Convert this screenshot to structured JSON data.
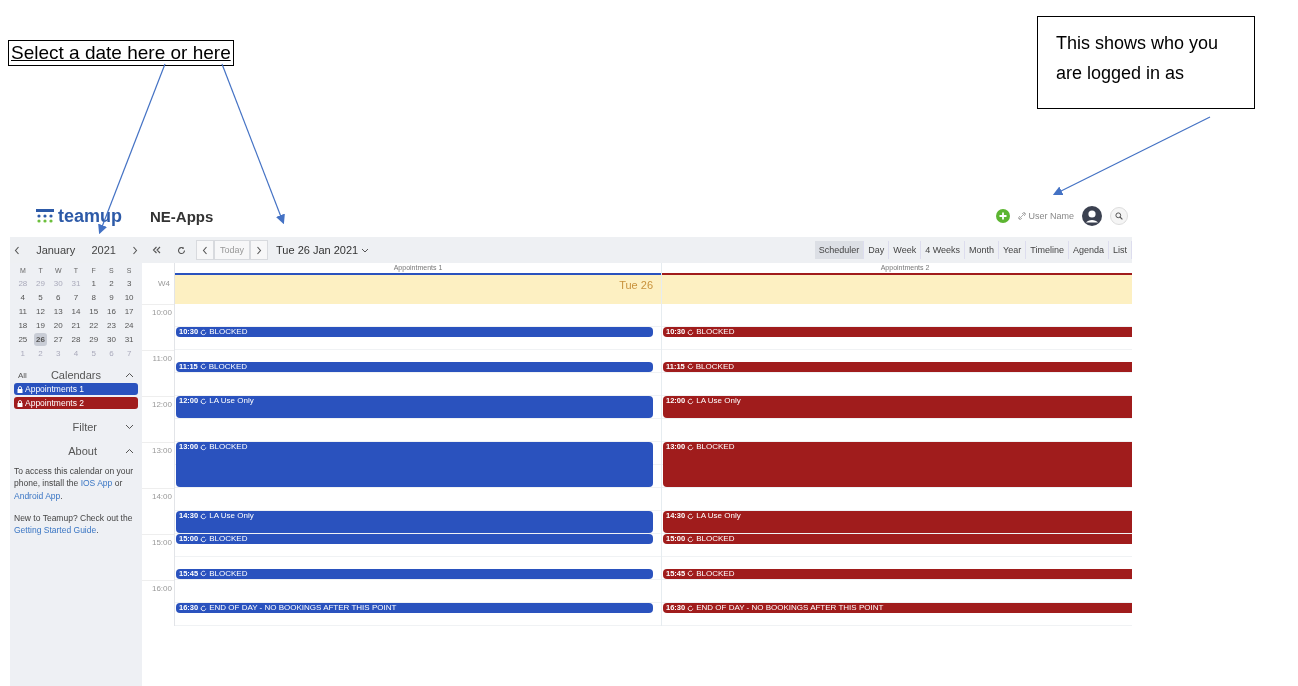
{
  "annotations": [
    {
      "text": "Select a date here or here"
    },
    {
      "text": "This shows who you are logged in as"
    }
  ],
  "app": {
    "logo": "teamup",
    "title": "NE-Apps",
    "user": "User Name"
  },
  "toolbar": {
    "today": "Today",
    "date": "Tue 26 Jan 2021"
  },
  "views": [
    {
      "label": "Scheduler",
      "selected": true
    },
    {
      "label": "Day",
      "selected": false
    },
    {
      "label": "Week",
      "selected": false
    },
    {
      "label": "4 Weeks",
      "selected": false
    },
    {
      "label": "Month",
      "selected": false
    },
    {
      "label": "Year",
      "selected": false
    },
    {
      "label": "Timeline",
      "selected": false
    },
    {
      "label": "Agenda",
      "selected": false
    },
    {
      "label": "List",
      "selected": false
    }
  ],
  "mini_calendar": {
    "month": "January",
    "year": "2021",
    "weekdays": [
      "M",
      "T",
      "W",
      "T",
      "F",
      "S",
      "S"
    ],
    "weeks": [
      {
        "days": [
          {
            "day": "28",
            "muted": true,
            "selected": false
          },
          {
            "day": "29",
            "muted": true,
            "selected": false
          },
          {
            "day": "30",
            "muted": true,
            "selected": false
          },
          {
            "day": "31",
            "muted": true,
            "selected": false
          },
          {
            "day": "1",
            "muted": false,
            "selected": false
          },
          {
            "day": "2",
            "muted": false,
            "selected": false
          },
          {
            "day": "3",
            "muted": false,
            "selected": false
          }
        ]
      },
      {
        "days": [
          {
            "day": "4",
            "muted": false,
            "selected": false
          },
          {
            "day": "5",
            "muted": false,
            "selected": false
          },
          {
            "day": "6",
            "muted": false,
            "selected": false
          },
          {
            "day": "7",
            "muted": false,
            "selected": false
          },
          {
            "day": "8",
            "muted": false,
            "selected": false
          },
          {
            "day": "9",
            "muted": false,
            "selected": false
          },
          {
            "day": "10",
            "muted": false,
            "selected": false
          }
        ]
      },
      {
        "days": [
          {
            "day": "11",
            "muted": false,
            "selected": false
          },
          {
            "day": "12",
            "muted": false,
            "selected": false
          },
          {
            "day": "13",
            "muted": false,
            "selected": false
          },
          {
            "day": "14",
            "muted": false,
            "selected": false
          },
          {
            "day": "15",
            "muted": false,
            "selected": false
          },
          {
            "day": "16",
            "muted": false,
            "selected": false
          },
          {
            "day": "17",
            "muted": false,
            "selected": false
          }
        ]
      },
      {
        "days": [
          {
            "day": "18",
            "muted": false,
            "selected": false
          },
          {
            "day": "19",
            "muted": false,
            "selected": false
          },
          {
            "day": "20",
            "muted": false,
            "selected": false
          },
          {
            "day": "21",
            "muted": false,
            "selected": false
          },
          {
            "day": "22",
            "muted": false,
            "selected": false
          },
          {
            "day": "23",
            "muted": false,
            "selected": false
          },
          {
            "day": "24",
            "muted": false,
            "selected": false
          }
        ]
      },
      {
        "days": [
          {
            "day": "25",
            "muted": false,
            "selected": false
          },
          {
            "day": "26",
            "muted": false,
            "selected": true
          },
          {
            "day": "27",
            "muted": false,
            "selected": false
          },
          {
            "day": "28",
            "muted": false,
            "selected": false
          },
          {
            "day": "29",
            "muted": false,
            "selected": false
          },
          {
            "day": "30",
            "muted": false,
            "selected": false
          },
          {
            "day": "31",
            "muted": false,
            "selected": false
          }
        ]
      },
      {
        "days": [
          {
            "day": "1",
            "muted": true,
            "selected": false
          },
          {
            "day": "2",
            "muted": true,
            "selected": false
          },
          {
            "day": "3",
            "muted": true,
            "selected": false
          },
          {
            "day": "4",
            "muted": true,
            "selected": false
          },
          {
            "day": "5",
            "muted": true,
            "selected": false
          },
          {
            "day": "6",
            "muted": true,
            "selected": false
          },
          {
            "day": "7",
            "muted": true,
            "selected": false
          }
        ]
      }
    ]
  },
  "calendars_section": {
    "all": "All",
    "title": "Calendars",
    "expanded": true,
    "items": [
      {
        "name": "Appointments 1",
        "color": "#2a52be"
      },
      {
        "name": "Appointments 2",
        "color": "#a01c1c"
      }
    ]
  },
  "filter_section": {
    "title": "Filter",
    "expanded": false
  },
  "about_section": {
    "title": "About",
    "expanded": true,
    "paragraphs": [
      [
        {
          "kind": "text",
          "text": "To access this calendar on your phone, install the "
        },
        {
          "kind": "link",
          "text": "IOS App"
        },
        {
          "kind": "text",
          "text": " or "
        },
        {
          "kind": "link",
          "text": "Android App"
        },
        {
          "kind": "text",
          "text": "."
        }
      ],
      [
        {
          "kind": "text",
          "text": "New to Teamup? Check out the "
        },
        {
          "kind": "link",
          "text": "Getting Started Guide"
        },
        {
          "kind": "text",
          "text": "."
        }
      ]
    ]
  },
  "scheduler": {
    "week": "W4",
    "day": "Tue 26",
    "hours": [
      "10:00",
      "11:00",
      "12:00",
      "13:00",
      "14:00",
      "15:00",
      "16:00"
    ],
    "columns": [
      {
        "name": "Appointments 1",
        "color": "#2a52be",
        "events": [
          {
            "time": "10:30",
            "title": "BLOCKED",
            "kind": "short"
          },
          {
            "time": "11:15",
            "title": "BLOCKED",
            "kind": "short"
          },
          {
            "time": "12:00",
            "title": "LA Use Only",
            "kind": "medium"
          },
          {
            "time": "13:00",
            "title": "BLOCKED",
            "kind": "long"
          },
          {
            "time": "14:30",
            "title": "LA Use Only",
            "kind": "medium"
          },
          {
            "time": "15:00",
            "title": "BLOCKED",
            "kind": "short"
          },
          {
            "time": "15:45",
            "title": "BLOCKED",
            "kind": "short"
          },
          {
            "time": "16:30",
            "title": "END OF DAY - NO BOOKINGS AFTER THIS POINT",
            "kind": "short"
          }
        ]
      },
      {
        "name": "Appointments 2",
        "color": "#a01c1c",
        "events": [
          {
            "time": "10:30",
            "title": "BLOCKED",
            "kind": "short"
          },
          {
            "time": "11:15",
            "title": "BLOCKED",
            "kind": "short"
          },
          {
            "time": "12:00",
            "title": "LA Use Only",
            "kind": "medium"
          },
          {
            "time": "13:00",
            "title": "BLOCKED",
            "kind": "long"
          },
          {
            "time": "14:30",
            "title": "LA Use Only",
            "kind": "medium"
          },
          {
            "time": "15:00",
            "title": "BLOCKED",
            "kind": "short"
          },
          {
            "time": "15:45",
            "title": "BLOCKED",
            "kind": "short"
          },
          {
            "time": "16:30",
            "title": "END OF DAY - NO BOOKINGS AFTER THIS POINT",
            "kind": "short"
          }
        ]
      }
    ]
  }
}
